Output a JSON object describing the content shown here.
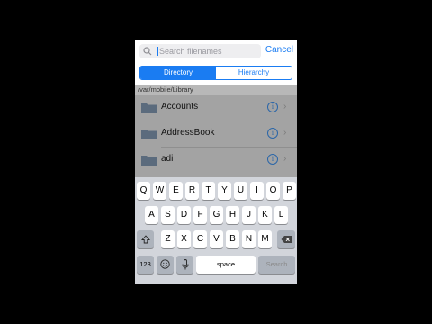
{
  "search": {
    "placeholder": "Search filenames",
    "cancel_label": "Cancel"
  },
  "segments": {
    "directory": "Directory",
    "hierarchy": "Hierarchy",
    "selected": "Directory"
  },
  "path": "/var/mobile/Library",
  "files": [
    {
      "name": "Accounts",
      "icon": "folder-icon"
    },
    {
      "name": "AddressBook",
      "icon": "folder-icon"
    },
    {
      "name": "adi",
      "icon": "folder-icon"
    }
  ],
  "info_glyph": "i",
  "chevron_glyph": "›",
  "keyboard": {
    "row1": [
      "Q",
      "W",
      "E",
      "R",
      "T",
      "Y",
      "U",
      "I",
      "O",
      "P"
    ],
    "row2": [
      "A",
      "S",
      "D",
      "F",
      "G",
      "H",
      "J",
      "K",
      "L"
    ],
    "row3": [
      "Z",
      "X",
      "C",
      "V",
      "B",
      "N",
      "M"
    ],
    "numbers_label": "123",
    "space_label": "space",
    "search_label": "Search",
    "shift_icon": "shift-arrow-icon",
    "delete_icon": "backspace-icon",
    "emoji_icon": "emoji-icon",
    "mic_icon": "microphone-icon"
  },
  "colors": {
    "accent": "#1a7cf2",
    "dim_overlay": "#a3a3a3",
    "keyboard_bg": "#d2d5db"
  }
}
